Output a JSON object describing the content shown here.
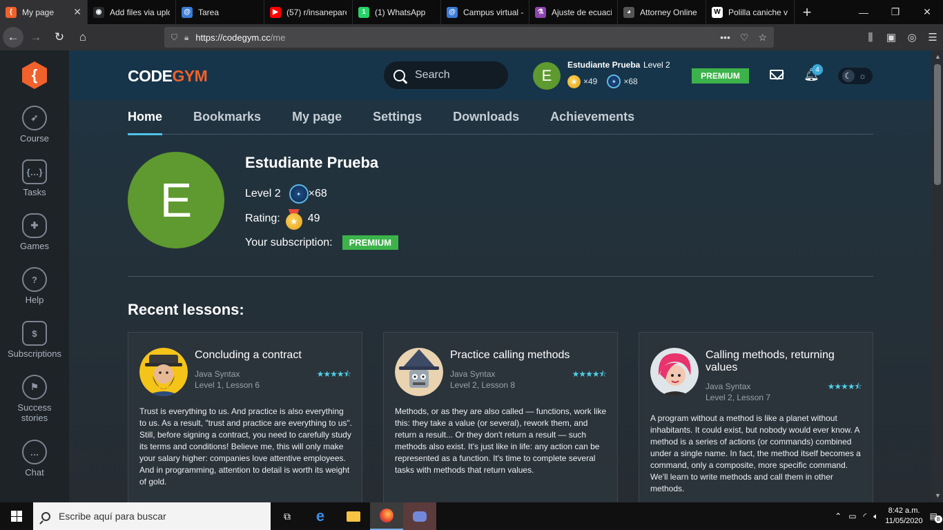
{
  "browser": {
    "tabs": [
      {
        "title": "My page",
        "active": true,
        "favicon_color": "#f1612b",
        "favicon_text": "{"
      },
      {
        "title": "Add files via uplo",
        "favicon_color": "#24292e",
        "favicon_text": "◉"
      },
      {
        "title": "Tarea",
        "favicon_color": "#3a7bd5",
        "favicon_text": "@"
      },
      {
        "title": "(57) r/insanepare",
        "favicon_color": "#ff0000",
        "favicon_text": "▶"
      },
      {
        "title": "(1) WhatsApp",
        "favicon_color": "#25d366",
        "favicon_text": "1"
      },
      {
        "title": "Campus virtual -",
        "favicon_color": "#3a7bd5",
        "favicon_text": "@"
      },
      {
        "title": "Ajuste de ecuaci",
        "favicon_color": "#8e44ad",
        "favicon_text": "⚗"
      },
      {
        "title": "Attorney Online",
        "favicon_color": "#555555",
        "favicon_text": "◕"
      },
      {
        "title": "Polilla caniche v",
        "favicon_color": "#ffffff",
        "favicon_text": "W"
      }
    ],
    "url_host": "https://codegym.cc",
    "url_path": "/me"
  },
  "sidebar": {
    "items": [
      {
        "label": "Course",
        "icon": "rocket-icon"
      },
      {
        "label": "Tasks",
        "icon": "braces-icon"
      },
      {
        "label": "Games",
        "icon": "gamepad-icon"
      },
      {
        "label": "Help",
        "icon": "help-bubble-icon"
      },
      {
        "label": "Subscriptions",
        "icon": "dollar-icon"
      },
      {
        "label": "Success",
        "label2": "stories",
        "icon": "flag-icon"
      },
      {
        "label": "Chat",
        "icon": "chat-icon"
      }
    ]
  },
  "header": {
    "brand_code": "CODE",
    "brand_gym": "GYM",
    "search_placeholder": "Search",
    "user_initial": "E",
    "user_name": "Estudiante Prueba",
    "user_level": "Level 2",
    "coins": "×49",
    "gems": "×68",
    "premium": "PREMIUM",
    "notifications": "4"
  },
  "tabs": [
    "Home",
    "Bookmarks",
    "My page",
    "Settings",
    "Downloads",
    "Achievements"
  ],
  "profile": {
    "initial": "E",
    "name": "Estudiante Prueba",
    "level": "Level 2",
    "gems": "×68",
    "rating_label": "Rating:",
    "rating": "49",
    "subscription_label": "Your subscription:",
    "subscription": "PREMIUM"
  },
  "recent": {
    "title": "Recent lessons:",
    "cards": [
      {
        "title": "Concluding a contract",
        "course": "Java Syntax",
        "lesson": "Level 1, Lesson 6",
        "stars": "★★★★⯪",
        "desc": "Trust is everything to us. And practice is also everything to us. As a result, \"trust and practice are everything to us\". Still, before signing a contract, you need to carefully study its terms and conditions! Believe me, this will only make your salary higher: companies love attentive employees. And in programming, attention to detail is worth its weight of gold."
      },
      {
        "title": "Practice calling methods",
        "course": "Java Syntax",
        "lesson": "Level 2, Lesson 8",
        "stars": "★★★★⯪",
        "desc": "Methods, or as they are also called — functions, work like this: they take a value (or several), rework them, and return a result... Or they don't return a result — such methods also exist. It's just like in life: any action can be represented as a function. It's time to complete several tasks with methods that return values."
      },
      {
        "title": "Calling methods, returning values",
        "course": "Java Syntax",
        "lesson": "Level 2, Lesson 7",
        "stars": "★★★★⯪",
        "desc": "A program without a method is like a planet without inhabitants. It could exist, but nobody would ever know. A method is a series of actions (or commands) combined under a single name. In fact, the method itself becomes a command, only a composite, more specific command. We'll learn to write methods and call them in other methods."
      }
    ]
  },
  "taskbar": {
    "search_placeholder": "Escribe aquí para buscar",
    "time": "8:42 a.m.",
    "date": "11/05/2020",
    "notif_count": "8"
  }
}
